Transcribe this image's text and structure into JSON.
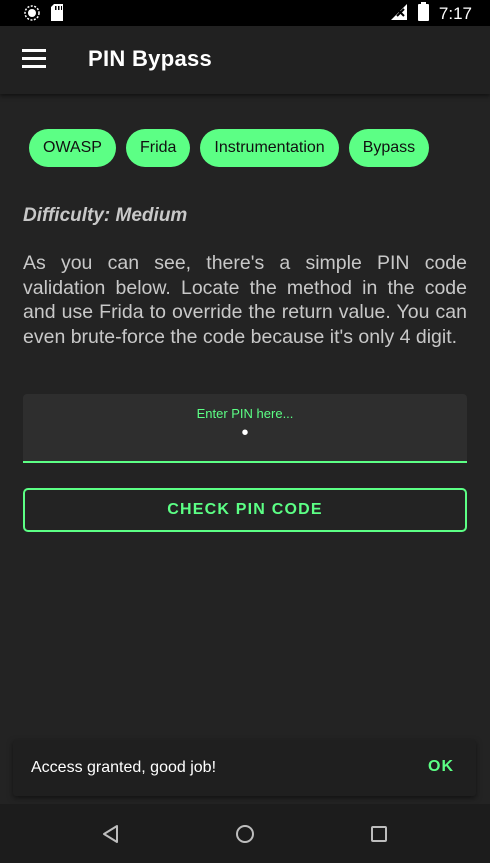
{
  "status_bar": {
    "time": "7:17",
    "icons": [
      "circle-status-icon",
      "sd-card-icon",
      "signal-off-icon",
      "battery-icon"
    ]
  },
  "app_bar": {
    "menu_icon": "hamburger-menu-icon",
    "title": "PIN Bypass"
  },
  "chips": [
    {
      "label": "OWASP"
    },
    {
      "label": "Frida"
    },
    {
      "label": "Instrumentation"
    },
    {
      "label": "Bypass"
    }
  ],
  "difficulty": "Difficulty: Medium",
  "description": "As you can see, there's a simple PIN code validation below. Locate the method in the code and use Frida to override the return value. You can even brute-force the code because it's only 4 digit.",
  "pin_input": {
    "label": "Enter PIN here...",
    "value": "•"
  },
  "check_button": {
    "label": "CHECK PIN CODE"
  },
  "snackbar": {
    "message": "Access granted, good job!",
    "action": "OK"
  },
  "nav_bar": {
    "icons": [
      "back-icon",
      "home-icon",
      "recents-icon"
    ]
  },
  "colors": {
    "accent": "#5cff85",
    "background": "#232323",
    "app_bar": "#212121",
    "text": "#c8c8c8"
  }
}
